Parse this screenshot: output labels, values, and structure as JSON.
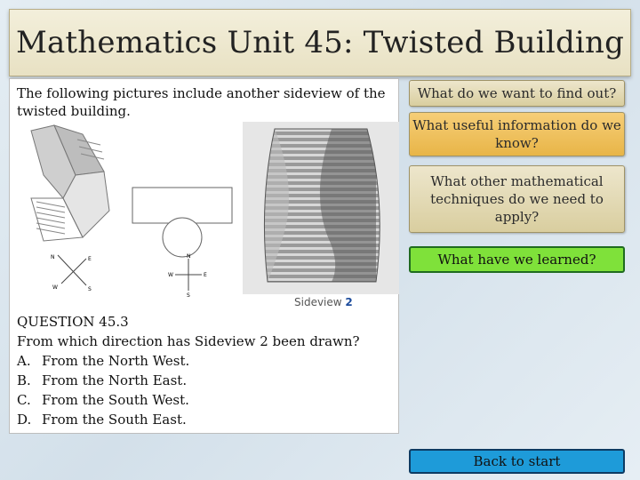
{
  "title": "Mathematics Unit 45: Twisted Building",
  "content": {
    "intro": "The following pictures include another sideview of the twisted building.",
    "figure": {
      "caption_word": "Sideview",
      "caption_number": "2",
      "compass_left": {
        "n": "N",
        "e": "E",
        "s": "S",
        "w": "W"
      },
      "compass_right": {
        "n": "N",
        "e": "E",
        "s": "S",
        "w": "W"
      }
    },
    "question": {
      "heading": "QUESTION 45.3",
      "prompt": "From which direction has Sideview 2 been drawn?",
      "options": [
        {
          "letter": "A.",
          "text": "From the North West."
        },
        {
          "letter": "B.",
          "text": "From the North East."
        },
        {
          "letter": "C.",
          "text": "From the South West."
        },
        {
          "letter": "D.",
          "text": "From the South East."
        }
      ]
    }
  },
  "nav": {
    "find_out": "What do we want to find out?",
    "useful_info": "What useful information do we know?",
    "techniques": "What other mathematical techniques do we need to apply?",
    "learned": "What have we learned?",
    "back": "Back to start"
  },
  "colors": {
    "tan_button": "#ddd3a8",
    "highlight_button": "#f0c260",
    "green_button": "#7fe13a",
    "blue_button": "#1e9bd9"
  }
}
